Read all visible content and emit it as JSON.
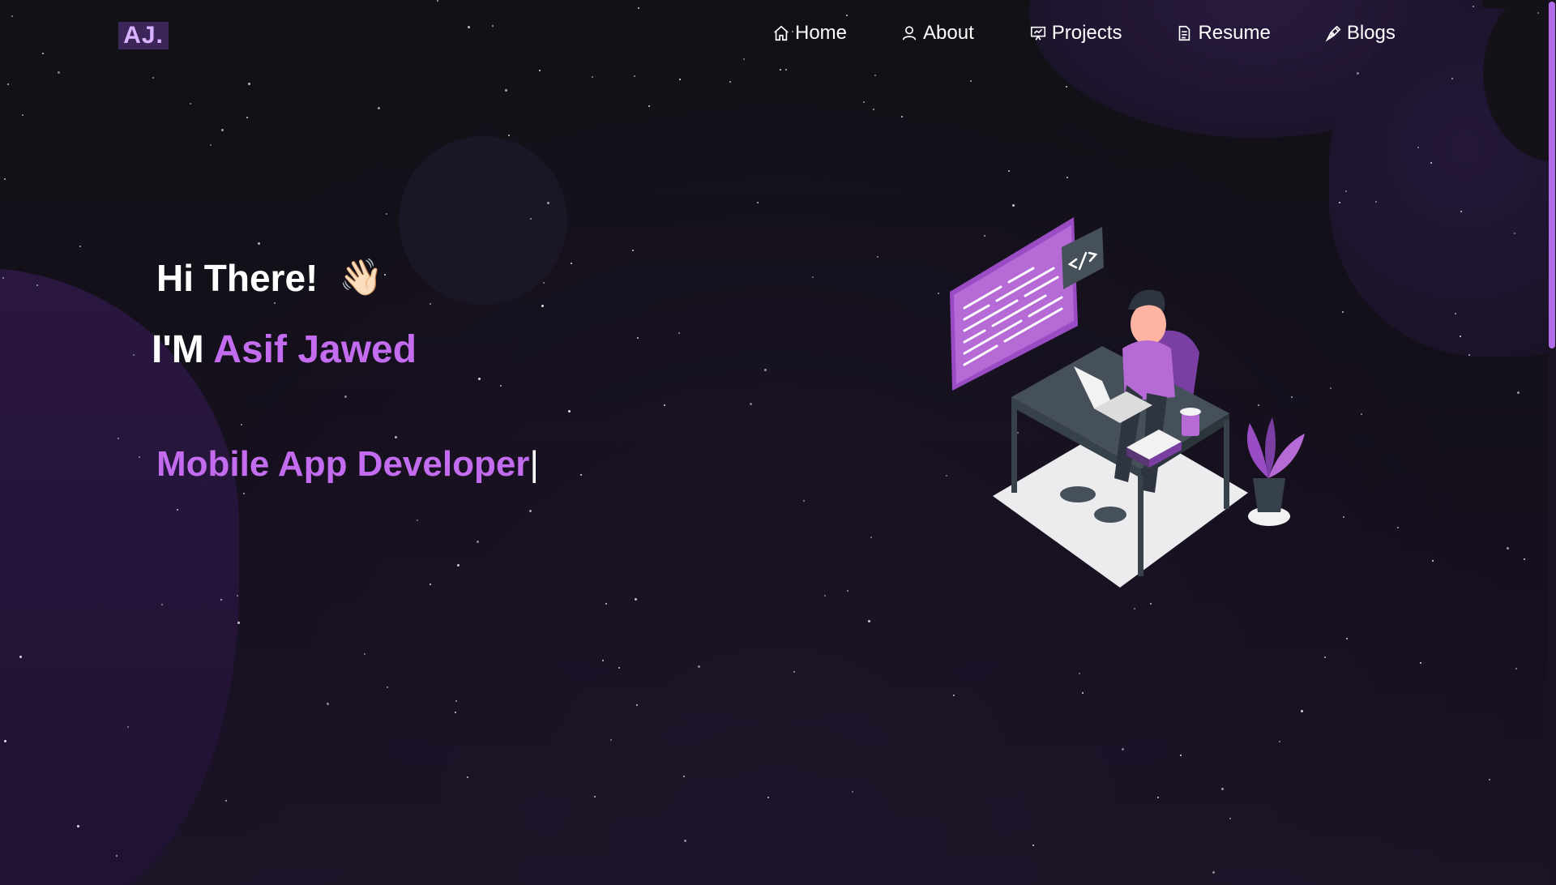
{
  "brand": {
    "logo_text": "AJ."
  },
  "nav": {
    "items": [
      {
        "label": "Home",
        "icon": "home-icon"
      },
      {
        "label": "About",
        "icon": "user-icon"
      },
      {
        "label": "Projects",
        "icon": "presentation-icon"
      },
      {
        "label": "Resume",
        "icon": "document-icon"
      },
      {
        "label": "Blogs",
        "icon": "pen-nib-icon"
      }
    ]
  },
  "hero": {
    "greeting": "Hi There!",
    "wave_emoji": "👋🏻",
    "intro_prefix": "I'M ",
    "name": "Asif Jawed",
    "role": "Mobile App Developer",
    "cursor": "|"
  },
  "colors": {
    "accent": "#c46cf0",
    "background": "#100d17",
    "logo_bg": "#3c2558",
    "scrollbar_thumb": "#b16ee8"
  }
}
